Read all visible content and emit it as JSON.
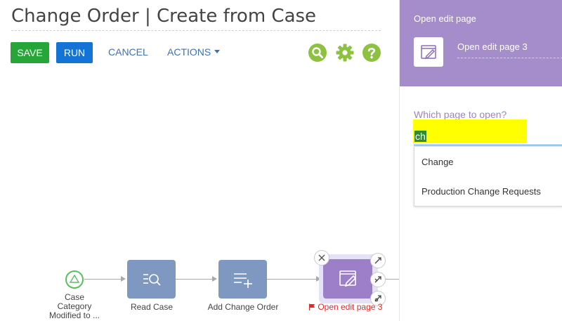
{
  "header": {
    "title": "Change Order | Create from Case"
  },
  "toolbar": {
    "save_label": "SAVE",
    "run_label": "RUN",
    "cancel_label": "CANCEL",
    "actions_label": "ACTIONS"
  },
  "toolbar_icons": [
    "search-icon",
    "gear-icon",
    "help-icon"
  ],
  "colors": {
    "save": "#26a639",
    "run": "#1474d6",
    "link": "#3c72b5",
    "tool_icon": "#8dc241",
    "panel_header": "#a58dcc",
    "highlight": "#ffff00"
  },
  "diagram": {
    "start_label": "Case Category Modified to ...",
    "start_label_lines": [
      "Case",
      "Category",
      "Modified to ..."
    ],
    "nodes": [
      {
        "label": "Read Case",
        "icon": "read-data-icon"
      },
      {
        "label": "Add Change Order",
        "icon": "add-data-icon"
      },
      {
        "label": "Open edit page 3",
        "icon": "edit-page-icon",
        "warning": true
      }
    ]
  },
  "panel": {
    "title": "Open edit page",
    "element_name": "Open edit page 3",
    "field_label": "Which page to open?",
    "search_value": "ch",
    "options": [
      "Change",
      "Production Change Requests"
    ]
  }
}
